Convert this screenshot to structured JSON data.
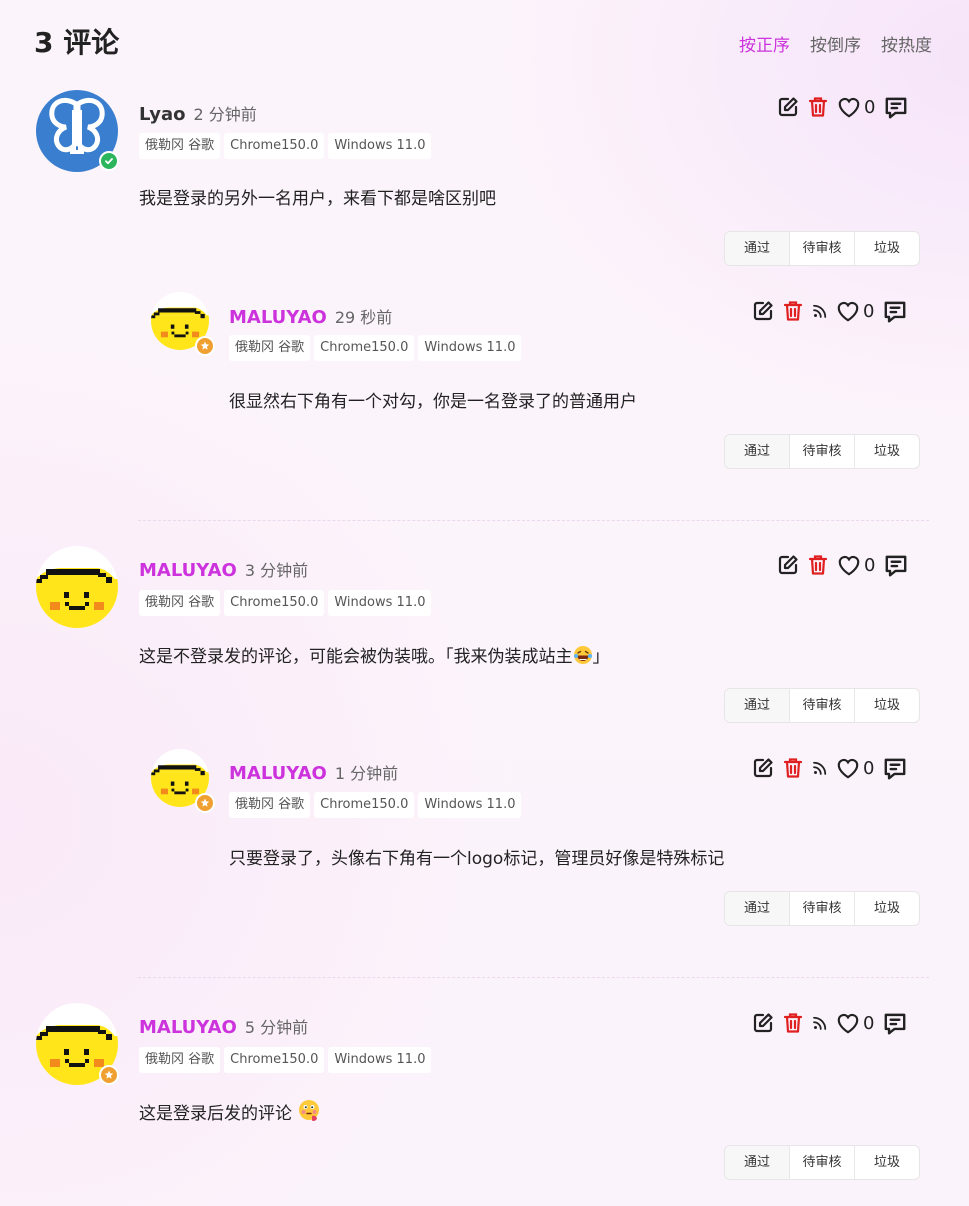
{
  "header": {
    "title": "3 评论",
    "sort": [
      "按正序",
      "按倒序",
      "按热度"
    ]
  },
  "colors": {
    "accent": "#cc33dd",
    "delete": "#e02020",
    "badge_ok": "#2db55d",
    "badge_admin": "#f0a030"
  },
  "comments": [
    {
      "name": "Lyao",
      "time": "2 分钟前",
      "tags": [
        "俄勒冈 谷歌",
        "Chrome150.0",
        "Windows 11.0"
      ],
      "content": "我是登录的另外一名用户，来看下都是啥区别吧",
      "likes": "0",
      "mod": [
        "通过",
        "待审核",
        "垃圾"
      ],
      "reply": {
        "name": "MALUYAO",
        "time": "29 秒前",
        "tags": [
          "俄勒冈 谷歌",
          "Chrome150.0",
          "Windows 11.0"
        ],
        "content": "很显然右下角有一个对勾，你是一名登录了的普通用户",
        "likes": "0",
        "mod": [
          "通过",
          "待审核",
          "垃圾"
        ]
      }
    },
    {
      "name": "MALUYAO",
      "time": "3 分钟前",
      "tags": [
        "俄勒冈 谷歌",
        "Chrome150.0",
        "Windows 11.0"
      ],
      "content": "这是不登录发的评论，可能会被伪装哦。「我来伪装成站主",
      "content_end": "」",
      "likes": "0",
      "mod": [
        "通过",
        "待审核",
        "垃圾"
      ],
      "reply": {
        "name": "MALUYAO",
        "time": "1 分钟前",
        "tags": [
          "俄勒冈 谷歌",
          "Chrome150.0",
          "Windows 11.0"
        ],
        "content": "只要登录了，头像右下角有一个logo标记，管理员好像是特殊标记",
        "likes": "0",
        "mod": [
          "通过",
          "待审核",
          "垃圾"
        ]
      }
    },
    {
      "name": "MALUYAO",
      "time": "5 分钟前",
      "tags": [
        "俄勒冈 谷歌",
        "Chrome150.0",
        "Windows 11.0"
      ],
      "content": "这是登录后发的评论",
      "likes": "0",
      "mod": [
        "通过",
        "待审核",
        "垃圾"
      ]
    }
  ]
}
